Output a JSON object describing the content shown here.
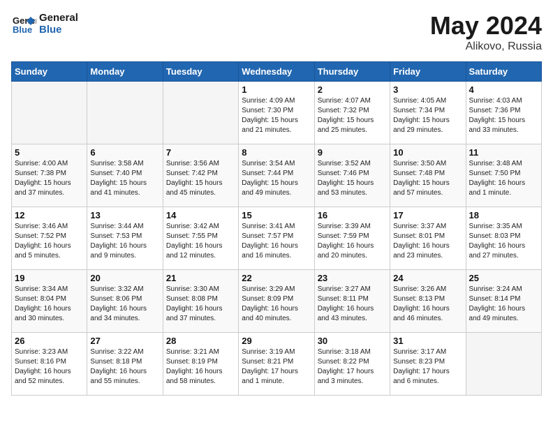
{
  "header": {
    "logo_line1": "General",
    "logo_line2": "Blue",
    "title": "May 2024",
    "subtitle": "Alikovo, Russia"
  },
  "weekdays": [
    "Sunday",
    "Monday",
    "Tuesday",
    "Wednesday",
    "Thursday",
    "Friday",
    "Saturday"
  ],
  "weeks": [
    [
      {
        "day": "",
        "info": ""
      },
      {
        "day": "",
        "info": ""
      },
      {
        "day": "",
        "info": ""
      },
      {
        "day": "1",
        "info": "Sunrise: 4:09 AM\nSunset: 7:30 PM\nDaylight: 15 hours\nand 21 minutes."
      },
      {
        "day": "2",
        "info": "Sunrise: 4:07 AM\nSunset: 7:32 PM\nDaylight: 15 hours\nand 25 minutes."
      },
      {
        "day": "3",
        "info": "Sunrise: 4:05 AM\nSunset: 7:34 PM\nDaylight: 15 hours\nand 29 minutes."
      },
      {
        "day": "4",
        "info": "Sunrise: 4:03 AM\nSunset: 7:36 PM\nDaylight: 15 hours\nand 33 minutes."
      }
    ],
    [
      {
        "day": "5",
        "info": "Sunrise: 4:00 AM\nSunset: 7:38 PM\nDaylight: 15 hours\nand 37 minutes."
      },
      {
        "day": "6",
        "info": "Sunrise: 3:58 AM\nSunset: 7:40 PM\nDaylight: 15 hours\nand 41 minutes."
      },
      {
        "day": "7",
        "info": "Sunrise: 3:56 AM\nSunset: 7:42 PM\nDaylight: 15 hours\nand 45 minutes."
      },
      {
        "day": "8",
        "info": "Sunrise: 3:54 AM\nSunset: 7:44 PM\nDaylight: 15 hours\nand 49 minutes."
      },
      {
        "day": "9",
        "info": "Sunrise: 3:52 AM\nSunset: 7:46 PM\nDaylight: 15 hours\nand 53 minutes."
      },
      {
        "day": "10",
        "info": "Sunrise: 3:50 AM\nSunset: 7:48 PM\nDaylight: 15 hours\nand 57 minutes."
      },
      {
        "day": "11",
        "info": "Sunrise: 3:48 AM\nSunset: 7:50 PM\nDaylight: 16 hours\nand 1 minute."
      }
    ],
    [
      {
        "day": "12",
        "info": "Sunrise: 3:46 AM\nSunset: 7:52 PM\nDaylight: 16 hours\nand 5 minutes."
      },
      {
        "day": "13",
        "info": "Sunrise: 3:44 AM\nSunset: 7:53 PM\nDaylight: 16 hours\nand 9 minutes."
      },
      {
        "day": "14",
        "info": "Sunrise: 3:42 AM\nSunset: 7:55 PM\nDaylight: 16 hours\nand 12 minutes."
      },
      {
        "day": "15",
        "info": "Sunrise: 3:41 AM\nSunset: 7:57 PM\nDaylight: 16 hours\nand 16 minutes."
      },
      {
        "day": "16",
        "info": "Sunrise: 3:39 AM\nSunset: 7:59 PM\nDaylight: 16 hours\nand 20 minutes."
      },
      {
        "day": "17",
        "info": "Sunrise: 3:37 AM\nSunset: 8:01 PM\nDaylight: 16 hours\nand 23 minutes."
      },
      {
        "day": "18",
        "info": "Sunrise: 3:35 AM\nSunset: 8:03 PM\nDaylight: 16 hours\nand 27 minutes."
      }
    ],
    [
      {
        "day": "19",
        "info": "Sunrise: 3:34 AM\nSunset: 8:04 PM\nDaylight: 16 hours\nand 30 minutes."
      },
      {
        "day": "20",
        "info": "Sunrise: 3:32 AM\nSunset: 8:06 PM\nDaylight: 16 hours\nand 34 minutes."
      },
      {
        "day": "21",
        "info": "Sunrise: 3:30 AM\nSunset: 8:08 PM\nDaylight: 16 hours\nand 37 minutes."
      },
      {
        "day": "22",
        "info": "Sunrise: 3:29 AM\nSunset: 8:09 PM\nDaylight: 16 hours\nand 40 minutes."
      },
      {
        "day": "23",
        "info": "Sunrise: 3:27 AM\nSunset: 8:11 PM\nDaylight: 16 hours\nand 43 minutes."
      },
      {
        "day": "24",
        "info": "Sunrise: 3:26 AM\nSunset: 8:13 PM\nDaylight: 16 hours\nand 46 minutes."
      },
      {
        "day": "25",
        "info": "Sunrise: 3:24 AM\nSunset: 8:14 PM\nDaylight: 16 hours\nand 49 minutes."
      }
    ],
    [
      {
        "day": "26",
        "info": "Sunrise: 3:23 AM\nSunset: 8:16 PM\nDaylight: 16 hours\nand 52 minutes."
      },
      {
        "day": "27",
        "info": "Sunrise: 3:22 AM\nSunset: 8:18 PM\nDaylight: 16 hours\nand 55 minutes."
      },
      {
        "day": "28",
        "info": "Sunrise: 3:21 AM\nSunset: 8:19 PM\nDaylight: 16 hours\nand 58 minutes."
      },
      {
        "day": "29",
        "info": "Sunrise: 3:19 AM\nSunset: 8:21 PM\nDaylight: 17 hours\nand 1 minute."
      },
      {
        "day": "30",
        "info": "Sunrise: 3:18 AM\nSunset: 8:22 PM\nDaylight: 17 hours\nand 3 minutes."
      },
      {
        "day": "31",
        "info": "Sunrise: 3:17 AM\nSunset: 8:23 PM\nDaylight: 17 hours\nand 6 minutes."
      },
      {
        "day": "",
        "info": ""
      }
    ]
  ]
}
